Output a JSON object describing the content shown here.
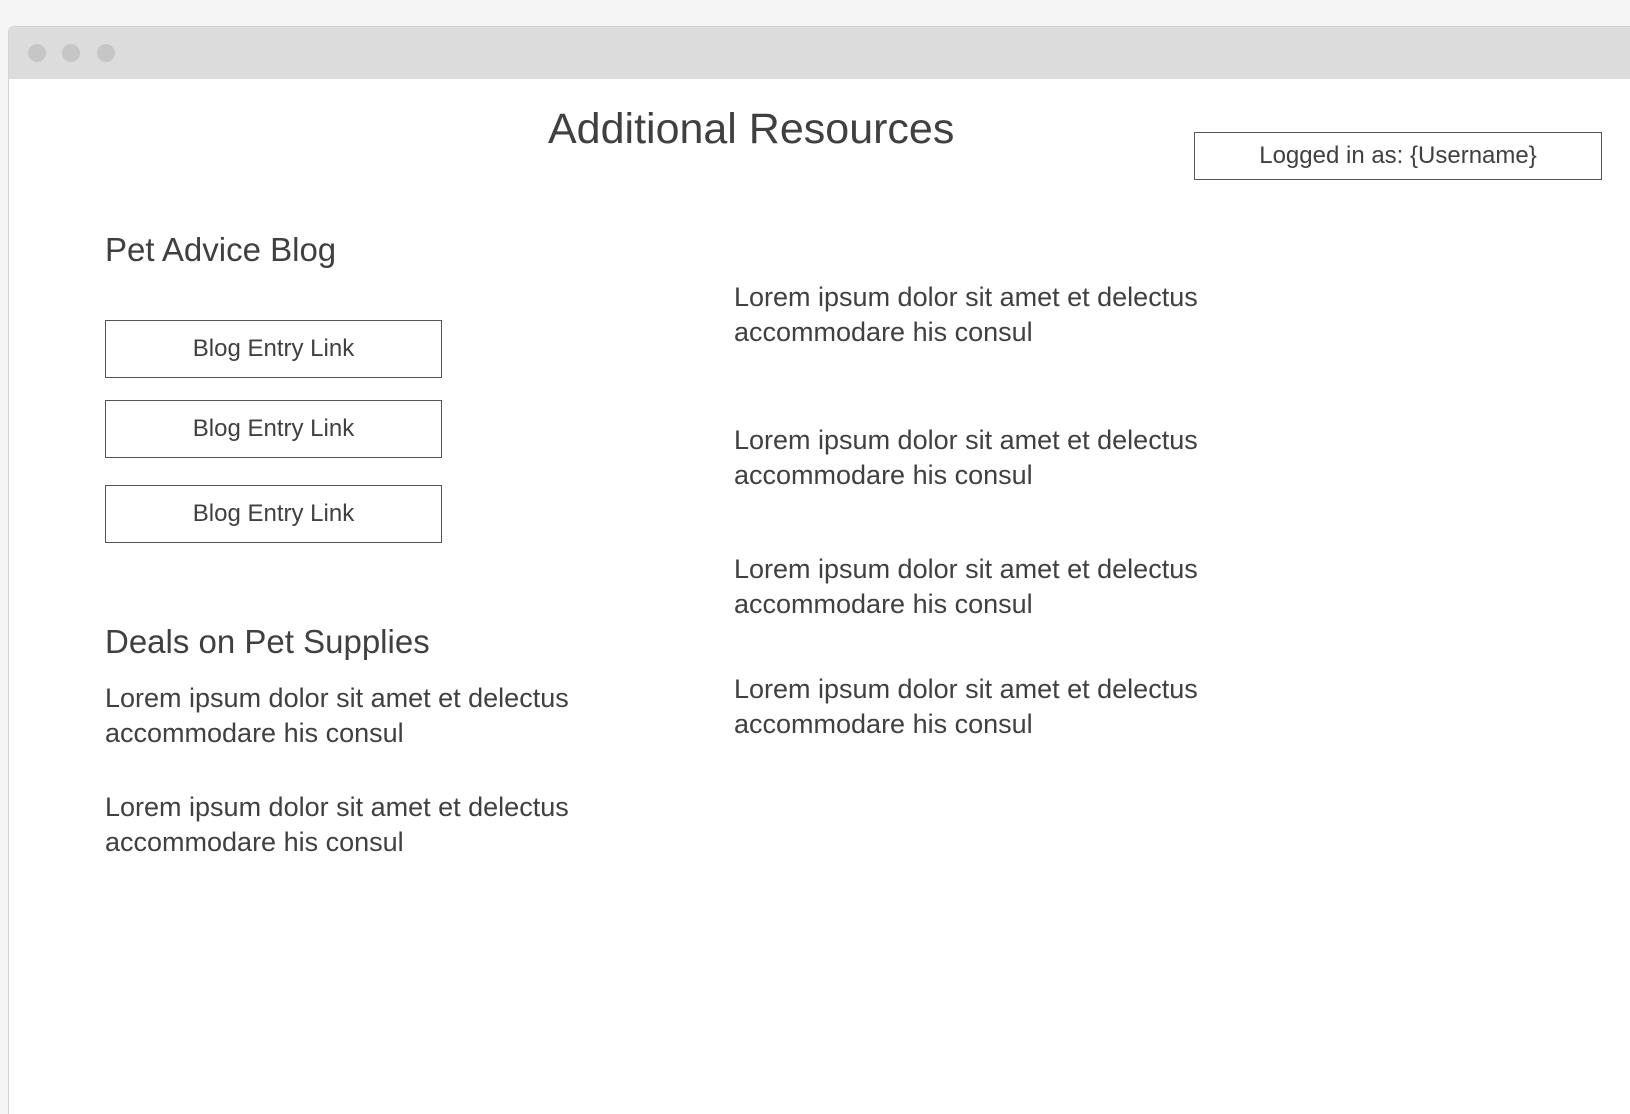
{
  "page": {
    "title": "Additional Resources",
    "login_status": "Logged in as: {Username}"
  },
  "blog": {
    "heading": "Pet Advice Blog",
    "links": [
      "Blog Entry Link",
      "Blog Entry Link",
      "Blog Entry Link"
    ]
  },
  "deals": {
    "heading": "Deals on Pet Supplies",
    "paragraphs": [
      "Lorem ipsum dolor sit amet et delectus accommodare his consul",
      "Lorem ipsum dolor sit amet et delectus accommodare his consul"
    ]
  },
  "right_column": {
    "paragraphs": [
      "Lorem ipsum dolor sit amet et delectus accommodare his consul",
      "Lorem ipsum dolor sit amet et delectus accommodare his consul",
      "Lorem ipsum dolor sit amet et delectus accommodare his consul",
      "Lorem ipsum dolor sit amet et delectus accommodare his consul"
    ]
  },
  "colors": {
    "text": "#404040",
    "border": "#555555",
    "titlebar": "#dcdcdc",
    "window_dot": "#c6c6c6",
    "page_background": "#f5f5f5"
  }
}
